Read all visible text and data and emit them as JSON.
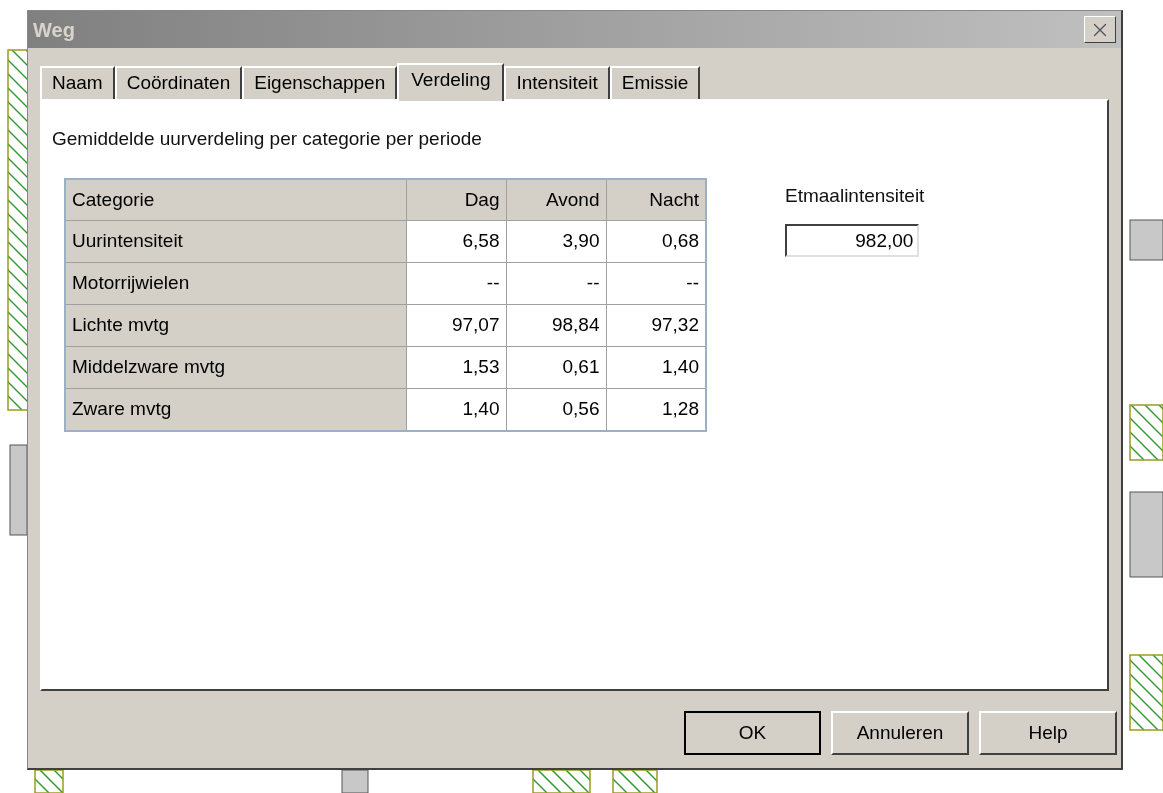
{
  "window": {
    "title": "Weg"
  },
  "tabs": [
    {
      "label": "Naam",
      "selected": false
    },
    {
      "label": "Coördinaten",
      "selected": false
    },
    {
      "label": "Eigenschappen",
      "selected": false
    },
    {
      "label": "Verdeling",
      "selected": true
    },
    {
      "label": "Intensiteit",
      "selected": false
    },
    {
      "label": "Emissie",
      "selected": false
    }
  ],
  "description": "Gemiddelde uurverdeling per categorie per periode",
  "table": {
    "columns": [
      "Categorie",
      "Dag",
      "Avond",
      "Nacht"
    ],
    "rows": [
      [
        "Uurintensiteit",
        "6,58",
        "3,90",
        "0,68"
      ],
      [
        "Motorrijwielen",
        "--",
        "--",
        "--"
      ],
      [
        "Lichte mvtg",
        "97,07",
        "98,84",
        "97,32"
      ],
      [
        "Middelzware mvtg",
        "1,53",
        "0,61",
        "1,40"
      ],
      [
        "Zware mvtg",
        "1,40",
        "0,56",
        "1,28"
      ]
    ]
  },
  "etmaal": {
    "label": "Etmaalintensiteit",
    "value": "982,00"
  },
  "buttons": [
    {
      "label": "OK",
      "default": true
    },
    {
      "label": "Annuleren",
      "default": false
    },
    {
      "label": "Help",
      "default": false
    }
  ]
}
